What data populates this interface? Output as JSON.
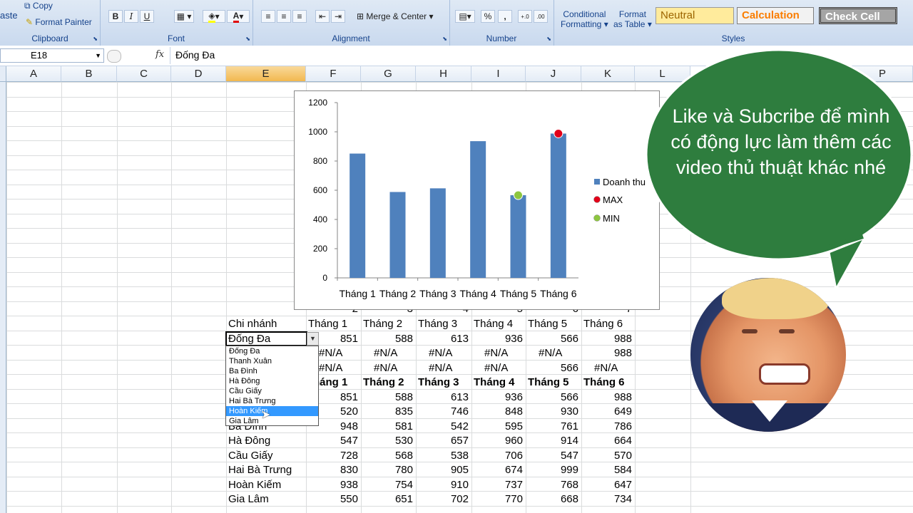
{
  "ribbon": {
    "clipboard": {
      "paste_label": "aste",
      "copy_label": "Copy",
      "format_painter_label": "Format Painter",
      "group_label": "Clipboard"
    },
    "font": {
      "bold": "B",
      "italic": "I",
      "underline": "U",
      "font_color_glyph": "A",
      "group_label": "Font"
    },
    "alignment": {
      "merge_label": "Merge & Center",
      "group_label": "Alignment"
    },
    "number": {
      "percent": "%",
      "comma": ",",
      "group_label": "Number"
    },
    "styles": {
      "conditional_l1": "Conditional",
      "conditional_l2": "Formatting",
      "format_table_l1": "Format",
      "format_table_l2": "as Table",
      "neutral": "Neutral",
      "calculation": "Calculation",
      "check_cell": "Check Cell",
      "group_label": "Styles"
    }
  },
  "formula_bar": {
    "name_box": "E18",
    "fx": "fx",
    "formula": "Đống Đa"
  },
  "columns": [
    "A",
    "B",
    "C",
    "D",
    "E",
    "F",
    "G",
    "H",
    "I",
    "J",
    "K",
    "L",
    "P"
  ],
  "partial_numbers": [
    "2",
    "3",
    "4",
    "5",
    "6",
    "7"
  ],
  "header_row": [
    "Chi nhánh",
    "Tháng 1",
    "Tháng 2",
    "Tháng 3",
    "Tháng 4",
    "Tháng 5",
    "Tháng 6"
  ],
  "selected_row": {
    "name": "Đống Đa",
    "values": [
      "851",
      "588",
      "613",
      "936",
      "566",
      "988"
    ]
  },
  "max_row": [
    "#N/A",
    "#N/A",
    "#N/A",
    "#N/A",
    "#N/A",
    "988"
  ],
  "min_row": [
    "#N/A",
    "#N/A",
    "#N/A",
    "#N/A",
    "566",
    "#N/A"
  ],
  "bold_header": [
    "háng 1",
    "Tháng 2",
    "Tháng 3",
    "Tháng 4",
    "Tháng 5",
    "Tháng 6"
  ],
  "table_rows": [
    {
      "name": "",
      "values": [
        "851",
        "588",
        "613",
        "936",
        "566",
        "988"
      ]
    },
    {
      "name": "",
      "values": [
        "520",
        "835",
        "746",
        "848",
        "930",
        "649"
      ]
    },
    {
      "name": "Ba Đình",
      "values": [
        "948",
        "581",
        "542",
        "595",
        "761",
        "786"
      ]
    },
    {
      "name": "Hà Đông",
      "values": [
        "547",
        "530",
        "657",
        "960",
        "914",
        "664"
      ]
    },
    {
      "name": "Cầu Giấy",
      "values": [
        "728",
        "568",
        "538",
        "706",
        "547",
        "570"
      ]
    },
    {
      "name": "Hai Bà Trưng",
      "values": [
        "830",
        "780",
        "905",
        "674",
        "999",
        "584"
      ]
    },
    {
      "name": "Hoàn Kiếm",
      "values": [
        "938",
        "754",
        "910",
        "737",
        "768",
        "647"
      ]
    },
    {
      "name": "Gia Lâm",
      "values": [
        "550",
        "651",
        "702",
        "770",
        "668",
        "734"
      ]
    }
  ],
  "dropdown_options": [
    "Đống Đa",
    "Thanh Xuân",
    "Ba Đình",
    "Hà Đông",
    "Cầu Giấy",
    "Hai Bà Trưng",
    "Hoàn Kiếm",
    "Gia Lâm"
  ],
  "dropdown_highlight": "Hoàn Kiếm",
  "chart_data": {
    "type": "bar",
    "categories": [
      "Tháng 1",
      "Tháng 2",
      "Tháng 3",
      "Tháng 4",
      "Tháng 5",
      "Tháng 6"
    ],
    "series": [
      {
        "name": "Doanh thu",
        "type": "bar",
        "color": "#4f81bd",
        "values": [
          851,
          588,
          613,
          936,
          566,
          988
        ]
      },
      {
        "name": "MAX",
        "type": "marker",
        "color": "#e2001a",
        "values": [
          null,
          null,
          null,
          null,
          null,
          988
        ]
      },
      {
        "name": "MIN",
        "type": "marker",
        "color": "#8dc63f",
        "values": [
          null,
          null,
          null,
          null,
          566,
          null
        ]
      }
    ],
    "yticks": [
      "0",
      "200",
      "400",
      "600",
      "800",
      "1000",
      "1200"
    ],
    "ylim": [
      0,
      1200
    ],
    "legend_position": "right",
    "grid": false
  },
  "bubble": {
    "text": "Like và Subcribe để mình có động lực làm thêm các video thủ thuật khác nhé",
    "color": "#2e7d3e"
  },
  "avatar": {
    "label": "avatar"
  }
}
